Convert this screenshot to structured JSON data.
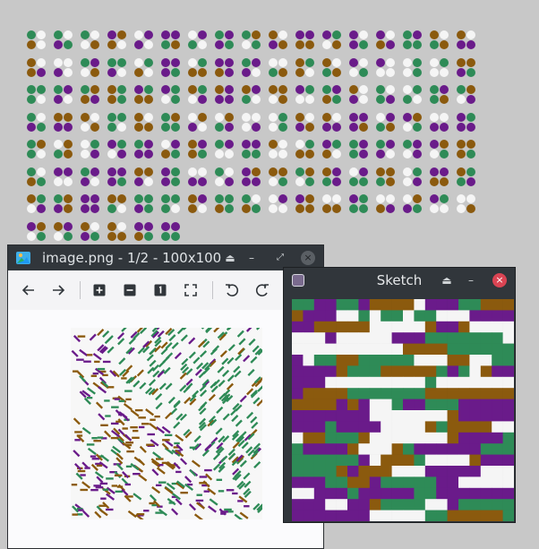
{
  "colors": {
    "background": "#c8c8c8",
    "palette": [
      "#2e8b57",
      "#6a1b8a",
      "#8b5a0e",
      "#f5f5f5"
    ],
    "titlebar": "#31363b",
    "close_red": "#da4453"
  },
  "tile_grid": {
    "rows": 8,
    "cols": 17,
    "count": 125
  },
  "viewer": {
    "title": "image.png - 1/2 - 100x100",
    "controls": {
      "keep_above": "⏏",
      "minimize": "–",
      "maximize": "⤢",
      "close": "×"
    },
    "toolbar": [
      "back-icon",
      "forward-icon",
      "zoom-in-icon",
      "zoom-out-icon",
      "actual-size-icon",
      "fit-icon",
      "rotate-left-icon",
      "rotate-right-icon"
    ]
  },
  "sketch": {
    "title": "Sketch",
    "controls": {
      "keep_above": "⏏",
      "minimize": "–",
      "close": "×"
    }
  }
}
